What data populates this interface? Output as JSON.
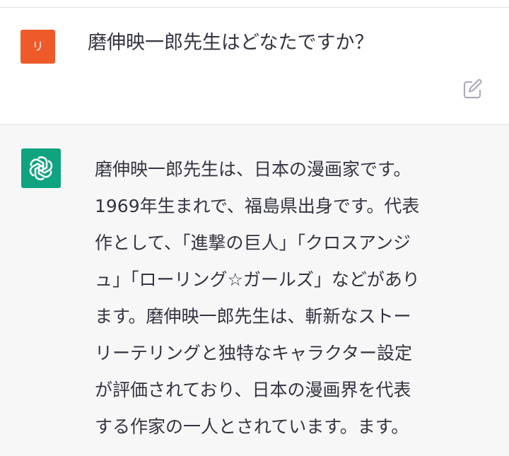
{
  "colors": {
    "user_avatar_bg": "#ef5a2a",
    "bot_avatar_bg": "#10a37f",
    "text": "#343541",
    "assistant_bg": "#f7f7f8",
    "edit_icon": "#acacbe"
  },
  "user_message": {
    "avatar_initial": "リ",
    "text": "磨伸映一郎先生はどなたですか？",
    "edit_icon": "pencil-square-icon"
  },
  "assistant_message": {
    "avatar_icon": "openai-logo-icon",
    "lines": [
      "磨伸映一郎先生は、日本の漫画家です。",
      "1969年生まれで、福島県出身です。代表",
      "作として、「進撃の巨人」「クロスアンジ",
      "ュ」「ローリング☆ガールズ」などがあり",
      "ます。磨伸映一郎先生は、斬新なストー",
      "リーテリングと独特なキャラクター設定",
      "が評価されており、日本の漫画界を代表",
      "する作家の一人とされています。ます。"
    ]
  }
}
